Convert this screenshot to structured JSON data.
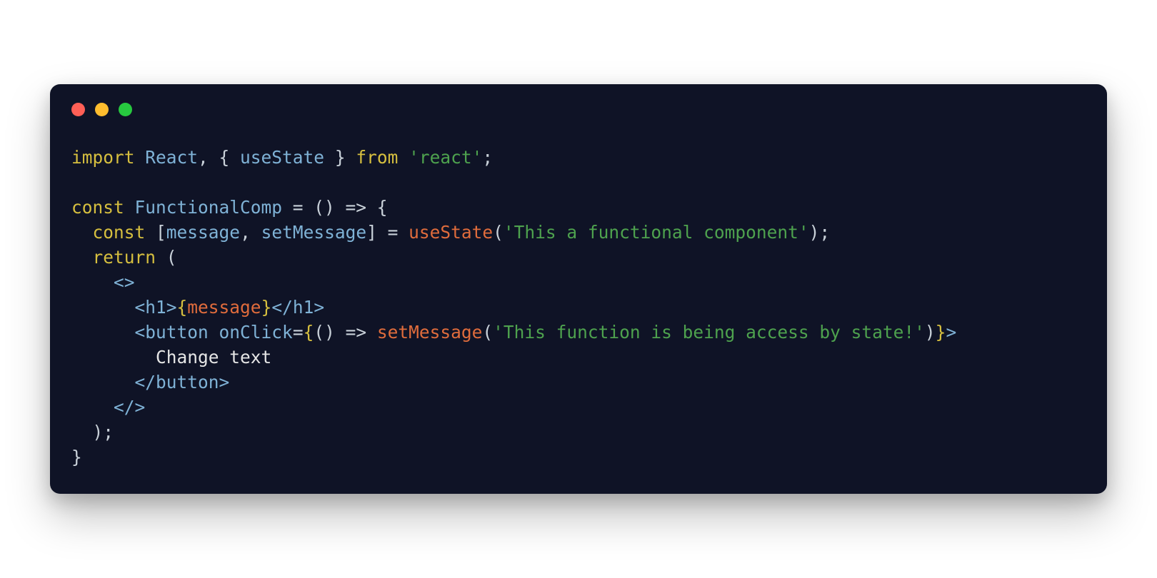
{
  "colors": {
    "background": "#0f1326",
    "dot_red": "#ff5f56",
    "dot_yellow": "#ffbd2e",
    "dot_green": "#27c93f",
    "keyword": "#d6bf3f",
    "default": "#c9d1d9",
    "type": "#7fb2d6",
    "func": "#e06c3c",
    "string": "#4ea24e",
    "plain": "#e6e6e6"
  },
  "titlebar": {
    "buttons": [
      "close",
      "minimize",
      "zoom"
    ]
  },
  "code": {
    "l1": {
      "a": "import",
      "b": " React",
      "c": ", { ",
      "d": "useState",
      "e": " } ",
      "f": "from",
      "g": " ",
      "h": "'react'",
      "i": ";"
    },
    "l2": "",
    "l3": {
      "a": "const",
      "b": " FunctionalComp ",
      "c": "= () => {"
    },
    "l4": {
      "a": "  ",
      "b": "const",
      "c": " [",
      "d": "message",
      "e": ", ",
      "f": "setMessage",
      "g": "] = ",
      "h": "useState",
      "i": "(",
      "j": "'This a functional component'",
      "k": ");"
    },
    "l5": {
      "a": "  ",
      "b": "return",
      "c": " ("
    },
    "l6": {
      "a": "    ",
      "b": "<>"
    },
    "l7": {
      "a": "      ",
      "b": "<h1>",
      "c": "{",
      "d": "message",
      "e": "}",
      "f": "</h1>"
    },
    "l8": {
      "a": "      ",
      "b": "<button",
      "c": " ",
      "d": "onClick",
      "e": "=",
      "f": "{",
      "g": "() => ",
      "h": "setMessage",
      "i": "(",
      "j": "'This function is being access by state!'",
      "k": ")",
      "l": "}",
      "m": ">"
    },
    "l9": {
      "a": "        ",
      "b": "Change text"
    },
    "l10": {
      "a": "      ",
      "b": "</button>"
    },
    "l11": {
      "a": "    ",
      "b": "</>"
    },
    "l12": {
      "a": "  );"
    },
    "l13": {
      "a": "}"
    }
  }
}
